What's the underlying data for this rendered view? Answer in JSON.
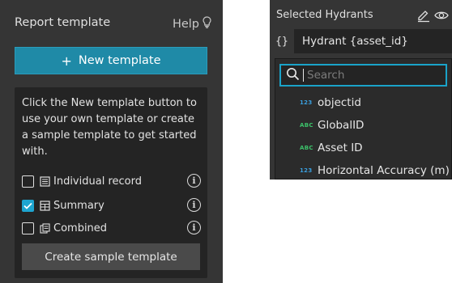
{
  "report_panel": {
    "title": "Report template",
    "help_label": "Help",
    "new_button_label": "New template",
    "instructions": "Click the New template button to use your own template or create a sample template to get started with.",
    "options": [
      {
        "label": "Individual record",
        "checked": false,
        "icon": "single-record-icon"
      },
      {
        "label": "Summary",
        "checked": true,
        "icon": "summary-table-icon"
      },
      {
        "label": "Combined",
        "checked": false,
        "icon": "combined-records-icon"
      }
    ],
    "create_sample_label": "Create sample template"
  },
  "field_panel": {
    "title": "Selected Hydrants",
    "expression_prefix": "{}",
    "expression_value": "Hydrant {asset_id}",
    "search_placeholder": "Search",
    "fields": [
      {
        "type": "123",
        "name": "objectid"
      },
      {
        "type": "ABC",
        "name": "GlobalID"
      },
      {
        "type": "ABC",
        "name": "Asset ID"
      },
      {
        "type": "123",
        "name": "Horizontal Accuracy (m)"
      }
    ]
  },
  "colors": {
    "panel_bg": "#353535",
    "box_bg": "#242424",
    "accent": "#1f8aa7",
    "checked": "#1ea5d0",
    "number_type": "#3aa0e0",
    "string_type": "#3cc26a"
  }
}
